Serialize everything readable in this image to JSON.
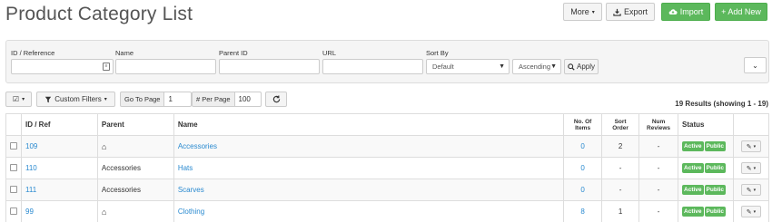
{
  "header": {
    "title": "Product Category List",
    "more_label": "More",
    "export_label": "Export",
    "import_label": "Import",
    "add_label": "+ Add New"
  },
  "filters": {
    "id_label": "ID / Reference",
    "name_label": "Name",
    "parent_label": "Parent ID",
    "url_label": "URL",
    "sort_label": "Sort By",
    "sort_value": "Default",
    "order_value": "Ascending",
    "apply_label": "Apply"
  },
  "toolbar": {
    "custom_filters_label": "Custom Filters",
    "goto_label": "Go To Page",
    "goto_value": "1",
    "perpage_label": "# Per Page",
    "perpage_value": "100",
    "results_text": "19 Results (showing 1 - 19)"
  },
  "table": {
    "headers": {
      "id": "ID / Ref",
      "parent": "Parent",
      "name": "Name",
      "items": "No. Of Items",
      "sort": "Sort Order",
      "reviews": "Num Reviews",
      "status": "Status"
    },
    "rows": [
      {
        "id": "109",
        "parent": "",
        "parent_icon": "home-icon",
        "name": "Accessories",
        "items": "0",
        "sort": "2",
        "reviews": "-",
        "status1": "Active",
        "status2": "Public"
      },
      {
        "id": "110",
        "parent": "Accessories",
        "parent_icon": "",
        "name": "Hats",
        "items": "0",
        "sort": "-",
        "reviews": "-",
        "status1": "Active",
        "status2": "Public"
      },
      {
        "id": "111",
        "parent": "Accessories",
        "parent_icon": "",
        "name": "Scarves",
        "items": "0",
        "sort": "-",
        "reviews": "-",
        "status1": "Active",
        "status2": "Public"
      },
      {
        "id": "99",
        "parent": "",
        "parent_icon": "home-icon",
        "name": "Clothing",
        "items": "8",
        "sort": "1",
        "reviews": "-",
        "status1": "Active",
        "status2": "Public"
      }
    ]
  },
  "colors": {
    "accent_green": "#5cb85c",
    "link_blue": "#2a8ad0"
  }
}
